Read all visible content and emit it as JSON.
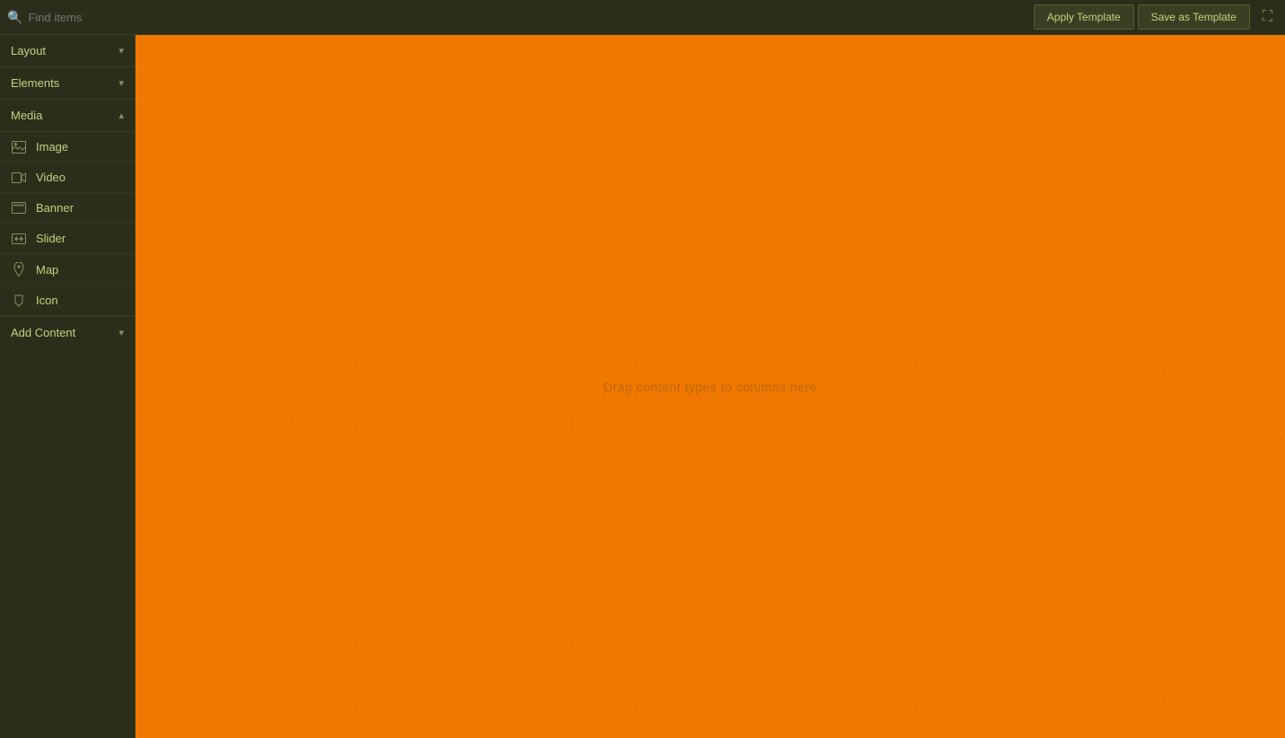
{
  "topbar": {
    "search_placeholder": "Find items",
    "apply_template_label": "Apply Template",
    "save_as_template_label": "Save as Template",
    "expand_icon": "⛶"
  },
  "sidebar": {
    "sections": [
      {
        "id": "layout",
        "label": "Layout",
        "expanded": false,
        "items": []
      },
      {
        "id": "elements",
        "label": "Elements",
        "expanded": false,
        "items": []
      },
      {
        "id": "media",
        "label": "Media",
        "expanded": true,
        "items": [
          {
            "id": "image",
            "label": "Image",
            "icon": "🖼"
          },
          {
            "id": "video",
            "label": "Video",
            "icon": "📹"
          },
          {
            "id": "banner",
            "label": "Banner",
            "icon": "🖥"
          },
          {
            "id": "slider",
            "label": "Slider",
            "icon": "🖵"
          },
          {
            "id": "map",
            "label": "Map",
            "icon": "📍"
          },
          {
            "id": "icon",
            "label": "Icon",
            "icon": "⚑"
          }
        ]
      }
    ],
    "add_content_label": "Add Content"
  },
  "canvas": {
    "drop_hint": "Drag content types to columns here",
    "background_color": "#f07800"
  }
}
